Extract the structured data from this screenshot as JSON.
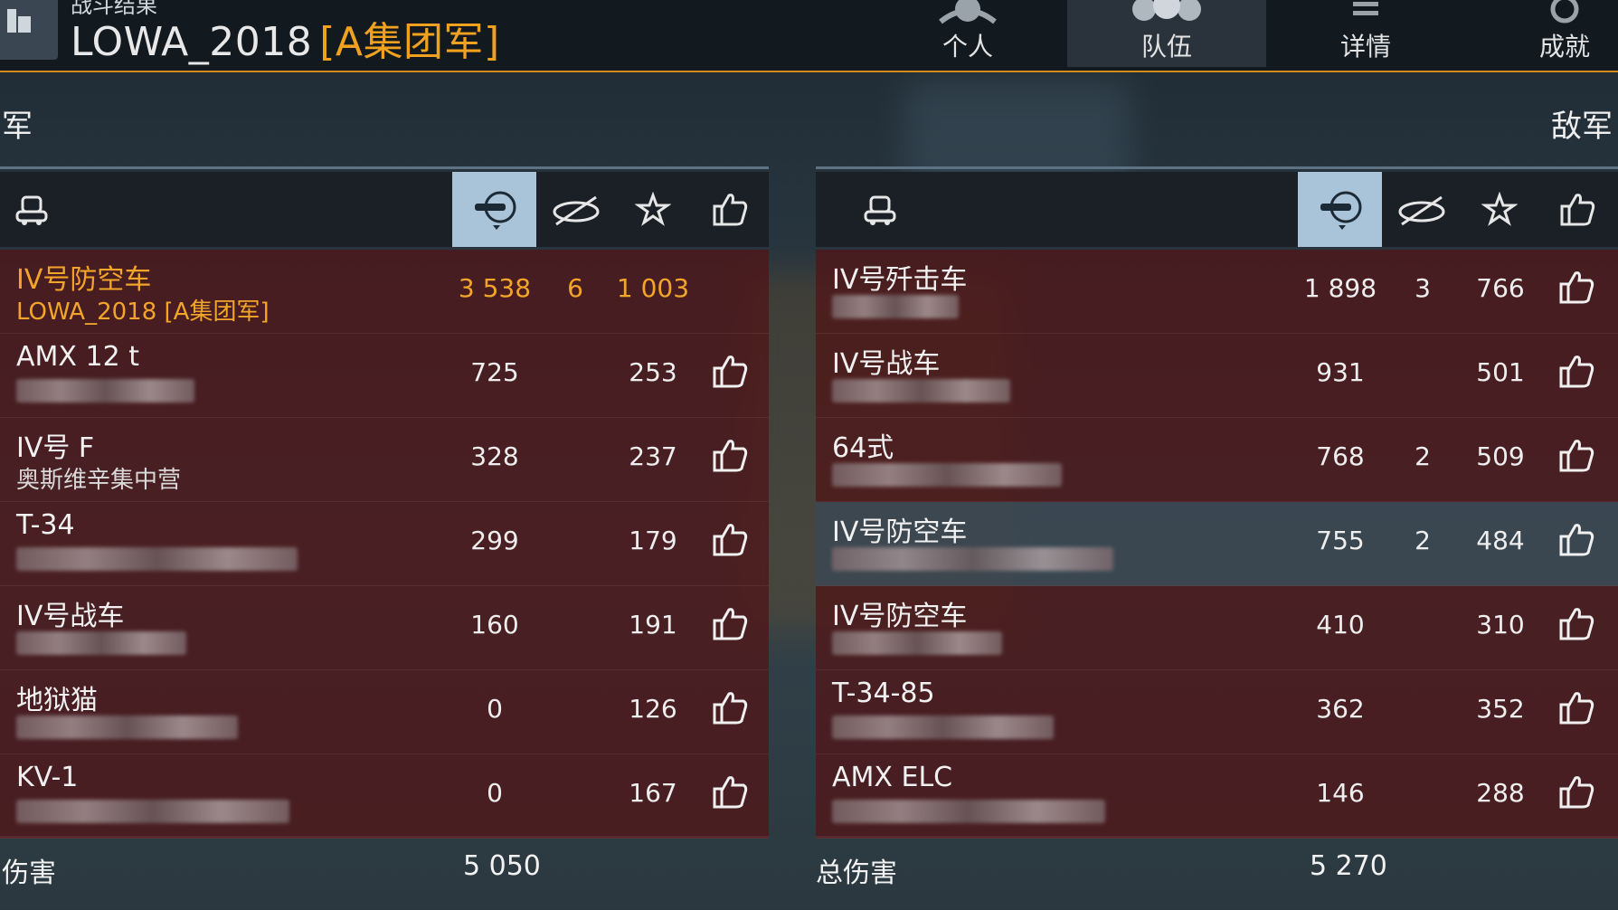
{
  "header": {
    "subtitle": "战斗结果",
    "player": "LOWA_2018",
    "clan": "[A集团军]",
    "tabs": [
      {
        "label": "个人",
        "icon": "soldier-icon"
      },
      {
        "label": "队伍",
        "icon": "team-icon"
      },
      {
        "label": "详情",
        "icon": "details-icon"
      },
      {
        "label": "成就",
        "icon": "medal-icon"
      }
    ],
    "active_tab": 1
  },
  "allies": {
    "title": "军",
    "columns": [
      "tank-icon",
      "damage-icon",
      "kills-icon",
      "exp-icon",
      "like-icon"
    ],
    "rows": [
      {
        "name": "IV号防空车",
        "sub": "LOWA_2018 [A集团军]",
        "damage": "3 538",
        "kills": "6",
        "exp": "1 003",
        "like": false,
        "me": true
      },
      {
        "name": "AMX 12 t",
        "sub": "",
        "damage": "725",
        "kills": "",
        "exp": "253",
        "like": true
      },
      {
        "name": "IV号 F",
        "sub": "奥斯维辛集中营",
        "damage": "328",
        "kills": "",
        "exp": "237",
        "like": true
      },
      {
        "name": "T-34",
        "sub": "",
        "damage": "299",
        "kills": "",
        "exp": "179",
        "like": true
      },
      {
        "name": "IV号战车",
        "sub": "",
        "damage": "160",
        "kills": "",
        "exp": "191",
        "like": true
      },
      {
        "name": "地狱猫",
        "sub": "",
        "damage": "0",
        "kills": "",
        "exp": "126",
        "like": true
      },
      {
        "name": "KV-1",
        "sub": "",
        "damage": "0",
        "kills": "",
        "exp": "167",
        "like": true
      }
    ],
    "total_label": "伤害",
    "total": "5 050"
  },
  "enemies": {
    "title": "敌军",
    "rows": [
      {
        "name": "IV号歼击车",
        "sub": "",
        "damage": "1 898",
        "kills": "3",
        "exp": "766",
        "like": true
      },
      {
        "name": "IV号战车",
        "sub": "",
        "damage": "931",
        "kills": "",
        "exp": "501",
        "like": true
      },
      {
        "name": "64式",
        "sub": "",
        "damage": "768",
        "kills": "2",
        "exp": "509",
        "like": true
      },
      {
        "name": "IV号防空车",
        "sub": "",
        "damage": "755",
        "kills": "2",
        "exp": "484",
        "like": true,
        "hl": true
      },
      {
        "name": "IV号防空车",
        "sub": "",
        "damage": "410",
        "kills": "",
        "exp": "310",
        "like": true
      },
      {
        "name": "T-34-85",
        "sub": "",
        "damage": "362",
        "kills": "",
        "exp": "352",
        "like": true
      },
      {
        "name": "AMX ELC",
        "sub": "",
        "damage": "146",
        "kills": "",
        "exp": "288",
        "like": true
      }
    ],
    "total_label": "总伤害",
    "total": "5 270"
  },
  "colors": {
    "accent": "#f0a21e",
    "row_red": "#501618",
    "selected_col": "#a9c3d8"
  }
}
